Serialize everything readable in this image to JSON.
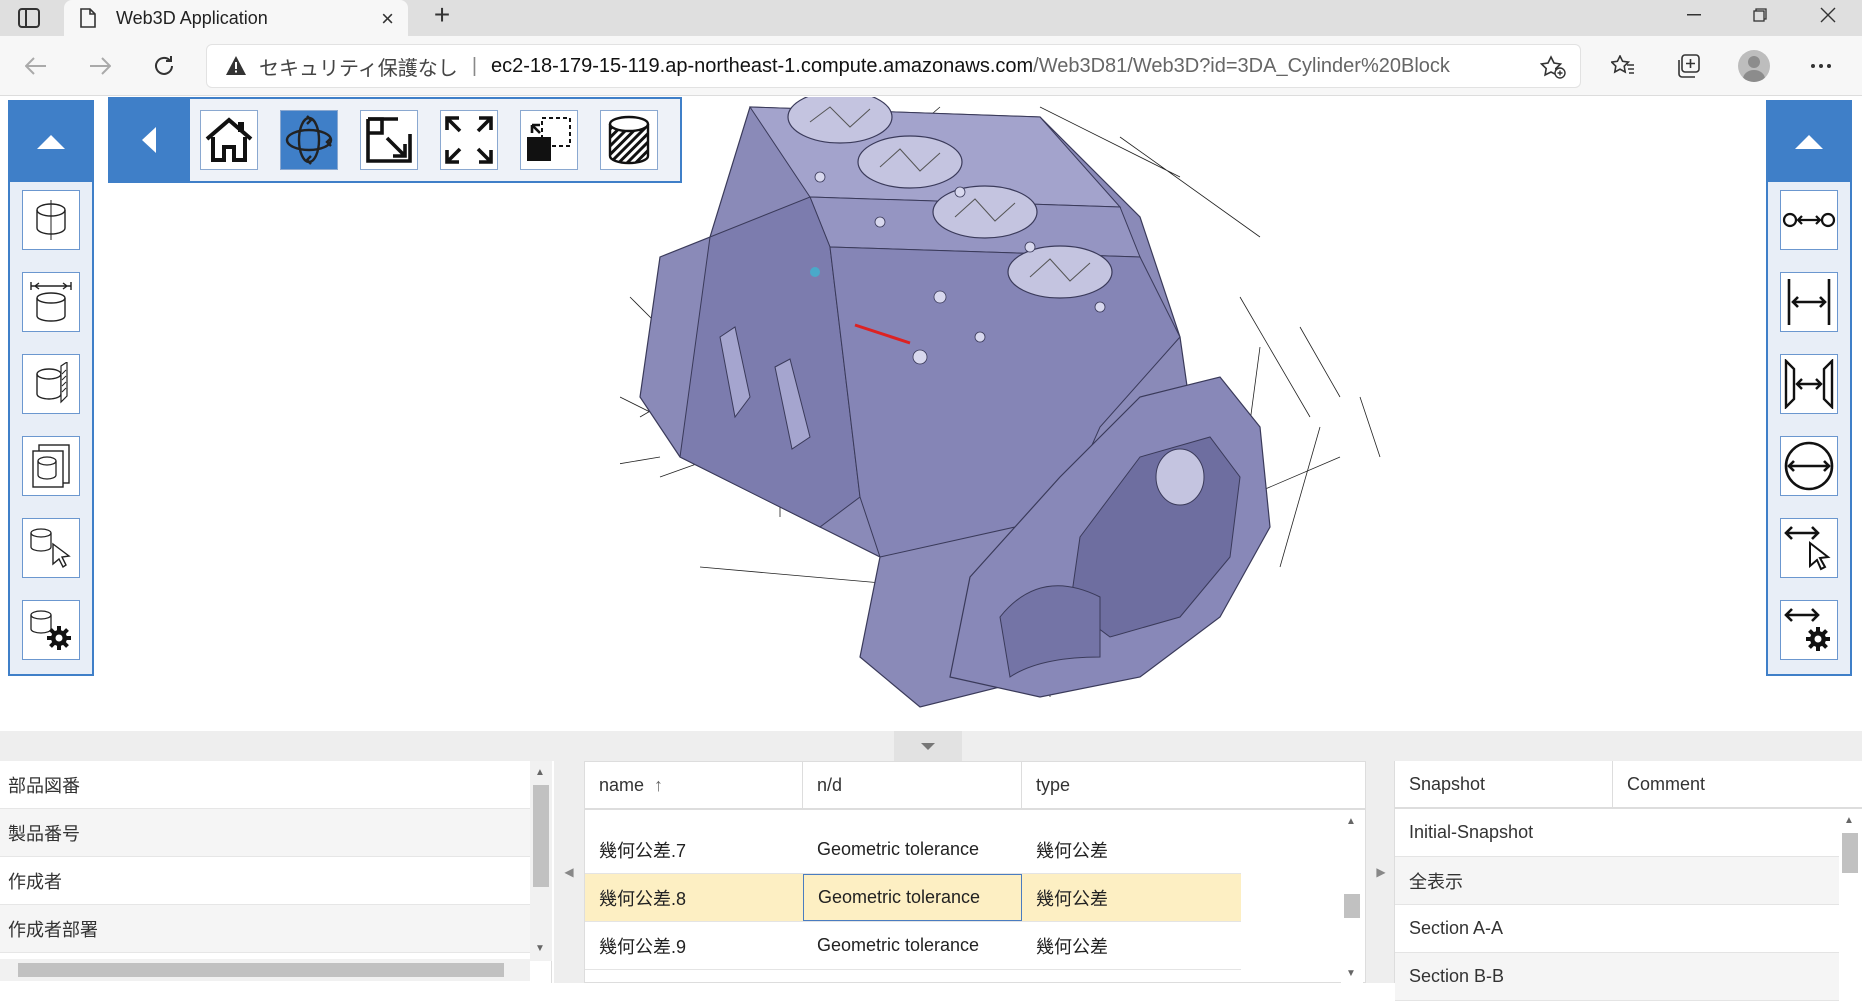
{
  "browser": {
    "tab_title": "Web3D Application",
    "tab_close": "×",
    "new_tab": "+",
    "security_label": "セキュリティ保護なし",
    "separator": "|",
    "url_host": "ec2-18-179-15-119.ap-northeast-1.compute.amazonaws.com",
    "url_path": "/Web3D81/Web3D?id=3DA_Cylinder%20Block"
  },
  "left_toolbar": {
    "buttons": [
      "shape-view-icon",
      "shape-bbox-icon",
      "shape-section-icon",
      "shape-layer-icon",
      "shape-select-icon",
      "shape-settings-icon"
    ]
  },
  "top_toolbar": {
    "buttons": [
      "home-icon",
      "rotate-icon",
      "zoom-window-icon",
      "fit-all-icon",
      "zoom-select-icon",
      "hatching-icon"
    ],
    "active": "rotate-icon"
  },
  "right_toolbar": {
    "buttons": [
      "distance-point-icon",
      "distance-line-icon",
      "distance-face-icon",
      "diameter-icon",
      "measure-select-icon",
      "measure-settings-icon"
    ]
  },
  "properties": {
    "rows": [
      "部品図番",
      "製品番号",
      "作成者",
      "作成者部署"
    ]
  },
  "pmi_grid": {
    "columns": [
      "name",
      "n/d",
      "type"
    ],
    "sort_indicator": "↑",
    "rows": [
      {
        "name": "幾何公差.7",
        "nd": "Geometric tolerance",
        "type": "幾何公差"
      },
      {
        "name": "幾何公差.8",
        "nd": "Geometric tolerance",
        "type": "幾何公差"
      },
      {
        "name": "幾何公差.9",
        "nd": "Geometric tolerance",
        "type": "幾何公差"
      }
    ],
    "selected_row": 1
  },
  "snapshots": {
    "columns": [
      "Snapshot",
      "Comment"
    ],
    "rows": [
      "Initial-Snapshot",
      "全表示",
      "Section A-A",
      "Section B-B"
    ]
  },
  "colors": {
    "accent": "#3f7fc8",
    "selected_row": "#fdefc3",
    "model": "#8a8ab8"
  }
}
